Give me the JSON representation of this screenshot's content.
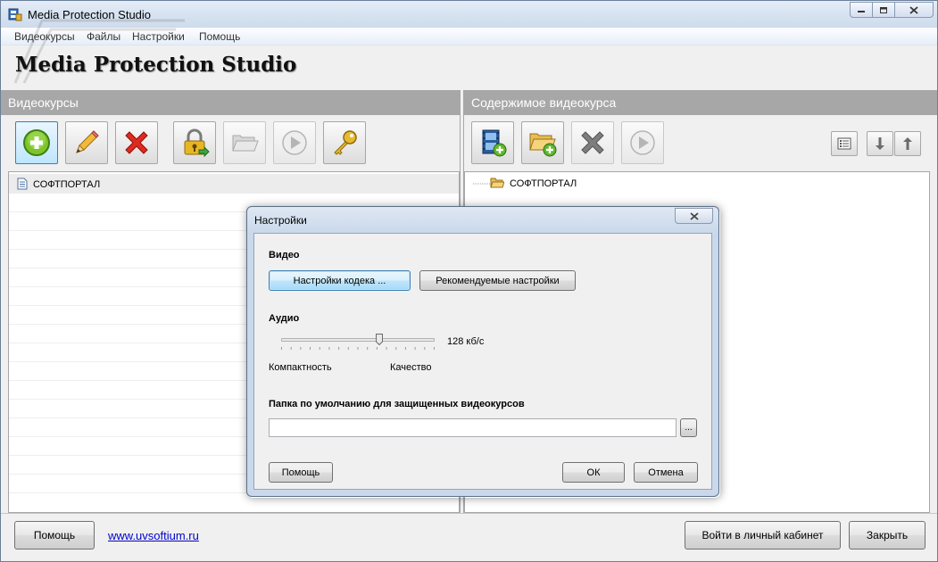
{
  "window": {
    "title": "Media Protection Studio",
    "heading": "Media Protection Studio"
  },
  "menu": [
    "Видеокурсы",
    "Файлы",
    "Настройки",
    "Помощь"
  ],
  "left_panel": {
    "title": "Видеокурсы",
    "toolbar": [
      {
        "icon": "add-icon",
        "state": "active"
      },
      {
        "icon": "pencil-icon",
        "state": "normal"
      },
      {
        "icon": "delete-icon",
        "state": "normal"
      },
      {
        "icon": "lock-icon",
        "state": "normal"
      },
      {
        "icon": "folder-open-icon",
        "state": "disabled"
      },
      {
        "icon": "play-icon",
        "state": "disabled"
      },
      {
        "icon": "key-icon",
        "state": "normal"
      }
    ],
    "items": [
      {
        "label": "СОФТПОРТАЛ",
        "icon": "document-icon"
      }
    ]
  },
  "right_panel": {
    "title": "Содержимое видеокурса",
    "toolbar": [
      {
        "icon": "add-video-icon",
        "state": "normal"
      },
      {
        "icon": "add-folder-icon",
        "state": "normal"
      },
      {
        "icon": "delete-icon",
        "state": "disabled"
      },
      {
        "icon": "play-icon",
        "state": "disabled"
      }
    ],
    "small_buttons": [
      {
        "icon": "properties-icon"
      },
      {
        "icon": "arrow-down-icon"
      },
      {
        "icon": "arrow-up-icon"
      }
    ],
    "tree": [
      {
        "label": "СОФТПОРТАЛ",
        "icon": "folder-icon"
      }
    ]
  },
  "bottom": {
    "help_label": "Помощь",
    "link_text": "www.uvsoftium.ru",
    "cabinet_label": "Войти в личный кабинет",
    "close_label": "Закрыть"
  },
  "dialog": {
    "title": "Настройки",
    "video_label": "Видео",
    "codec_button": "Настройки кодека ...",
    "recommended_button": "Рекомендуемые настройки",
    "audio_label": "Аудио",
    "bitrate_value": "128 кб/с",
    "slider_position": 0.64,
    "slider_min_label": "Компактность",
    "slider_max_label": "Качество",
    "folder_label": "Папка по умолчанию для защищенных видеокурсов",
    "folder_value": "",
    "browse_button": "...",
    "help_button": "Помощь",
    "ok_button": "ОК",
    "cancel_button": "Отмена"
  },
  "colors": {
    "panel_header": "#a7a7a7",
    "link": "#0000cc",
    "focus_border": "#3c7fb1"
  }
}
